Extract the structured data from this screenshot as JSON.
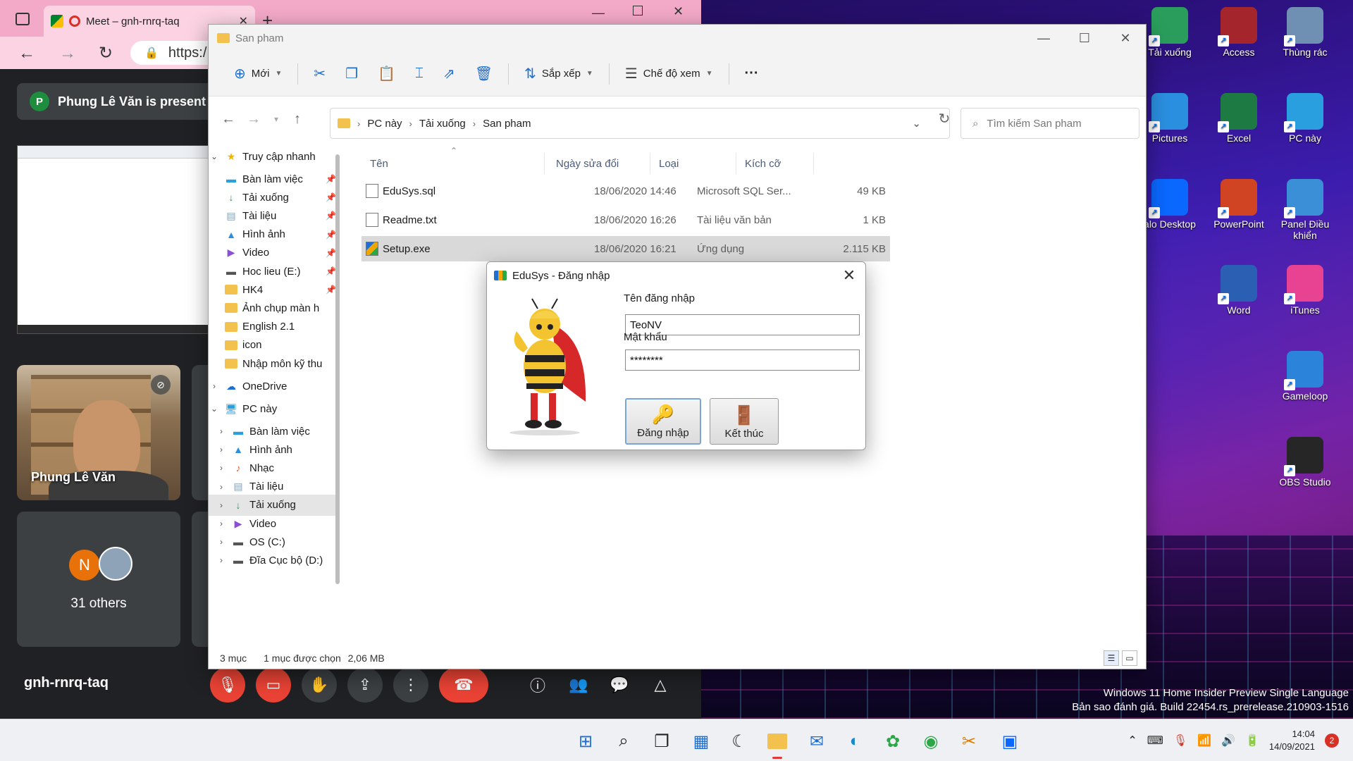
{
  "colors": {
    "accent_blue": "#1f6fd0",
    "meet_red": "#ea4335",
    "tab_pink": "#f3a9c8",
    "folder_yellow": "#f2c14e"
  },
  "desktop": {
    "icons": [
      {
        "label": "Tải xuống",
        "icon": "download-icon",
        "color": "#2a9d5c"
      },
      {
        "label": "Access",
        "icon": "access-icon",
        "color": "#a4262c"
      },
      {
        "label": "Thùng rác",
        "icon": "recycle-bin-icon",
        "color": "#6f8fb3"
      },
      {
        "label": "Pictures",
        "icon": "pictures-icon",
        "color": "#2b8fe0"
      },
      {
        "label": "Excel",
        "icon": "excel-icon",
        "color": "#1d7a43"
      },
      {
        "label": "PC này",
        "icon": "pc-icon",
        "color": "#2a9fe0"
      },
      {
        "label": "alo Desktop",
        "icon": "zalo-icon",
        "color": "#0a68ff"
      },
      {
        "label": "PowerPoint",
        "icon": "powerpoint-icon",
        "color": "#d04423"
      },
      {
        "label": "Panel Điều khiển",
        "icon": "control-panel-icon",
        "color": "#3a8fd6"
      },
      {
        "label": "Word",
        "icon": "word-icon",
        "color": "#2b5fb3"
      },
      {
        "label": "iTunes",
        "icon": "itunes-icon",
        "color": "#e84393"
      },
      {
        "label": "Gameloop",
        "icon": "gameloop-icon",
        "color": "#2b84d9"
      },
      {
        "label": "OBS Studio",
        "icon": "obs-icon",
        "color": "#262626"
      }
    ],
    "watermark_line1": "Windows 11 Home Insider Preview Single Language",
    "watermark_line2": "Bản sao đánh giá. Build 22454.rs_prerelease.210903-1516"
  },
  "browser": {
    "tab_title": "Meet – gnh-rnrq-taq",
    "address": "https:/",
    "presenting_initial": "P",
    "presenting_text": "Phung Lê Văn is present",
    "participant_name": "Phung Lê Văn",
    "others_initial": "N",
    "others_count": "31 others",
    "meeting_code": "gnh-rnrq-taq"
  },
  "explorer": {
    "title": "San pham",
    "toolbar": {
      "new": "Mới",
      "sort": "Sắp xếp",
      "view": "Chế độ xem",
      "more": "···"
    },
    "breadcrumb": [
      "PC này",
      "Tải xuống",
      "San pham"
    ],
    "search_placeholder": "Tìm kiếm San pham",
    "columns": {
      "name": "Tên",
      "date": "Ngày sửa đổi",
      "type": "Loại",
      "size": "Kích cỡ"
    },
    "files": [
      {
        "name": "EduSys.sql",
        "date": "18/06/2020 14:46",
        "type": "Microsoft SQL Ser...",
        "size": "49 KB"
      },
      {
        "name": "Readme.txt",
        "date": "18/06/2020 16:26",
        "type": "Tài liệu văn bản",
        "size": "1 KB"
      },
      {
        "name": "Setup.exe",
        "date": "18/06/2020 16:21",
        "type": "Ứng dụng",
        "size": "2.115 KB"
      }
    ],
    "nav": {
      "quick_access": "Truy cập nhanh",
      "quick_items": [
        "Bàn làm việc",
        "Tải xuống",
        "Tài liệu",
        "Hình ảnh",
        "Video",
        "Hoc lieu (E:)",
        "HK4",
        "Ảnh chụp màn h",
        "English 2.1",
        "icon",
        "Nhập môn kỹ thu"
      ],
      "onedrive": "OneDrive",
      "this_pc": "PC này",
      "pc_items": [
        "Bàn làm việc",
        "Hình ảnh",
        "Nhạc",
        "Tài liệu",
        "Tải xuống",
        "Video",
        "OS (C:)",
        "Đĩa Cục bộ (D:)"
      ]
    },
    "status": {
      "count": "3 mục",
      "selected": "1 mục được chọn",
      "size": "2,06 MB"
    }
  },
  "login": {
    "title": "EduSys - Đăng nhập",
    "username_label": "Tên đăng nhập",
    "username_value": "TeoNV",
    "password_label": "Mật khẩu",
    "password_value": "********",
    "login_button": "Đăng nhập",
    "exit_button": "Kết thúc"
  },
  "taskbar": {
    "time": "14:04",
    "date": "14/09/2021",
    "notifications": "2"
  }
}
